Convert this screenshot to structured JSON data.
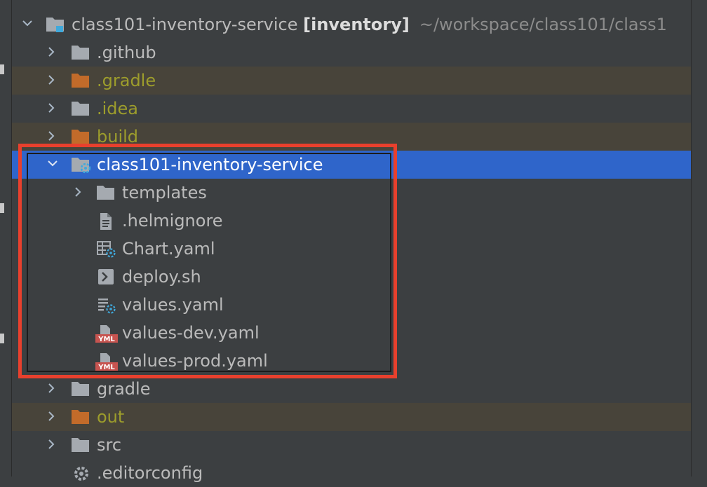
{
  "project": {
    "name": "class101-inventory-service",
    "module": "[inventory]",
    "path": "~/workspace/class101/class1"
  },
  "tree": {
    "github": ".github",
    "gradle_hidden": ".gradle",
    "idea": ".idea",
    "build": "build",
    "chart_folder": "class101-inventory-service",
    "templates": "templates",
    "helmignore": ".helmignore",
    "chart_yaml": "Chart.yaml",
    "deploy_sh": "deploy.sh",
    "values_yaml": "values.yaml",
    "values_dev": "values-dev.yaml",
    "values_prod": "values-prod.yaml",
    "gradle": "gradle",
    "out": "out",
    "src": "src",
    "editorconfig": ".editorconfig"
  },
  "colors": {
    "selection": "#2f65ca",
    "ignored_text": "#9d9d2c",
    "ignored_folder": "#c26b2a",
    "folder": "#a5aab0",
    "highlight_border": "#e8402d"
  }
}
